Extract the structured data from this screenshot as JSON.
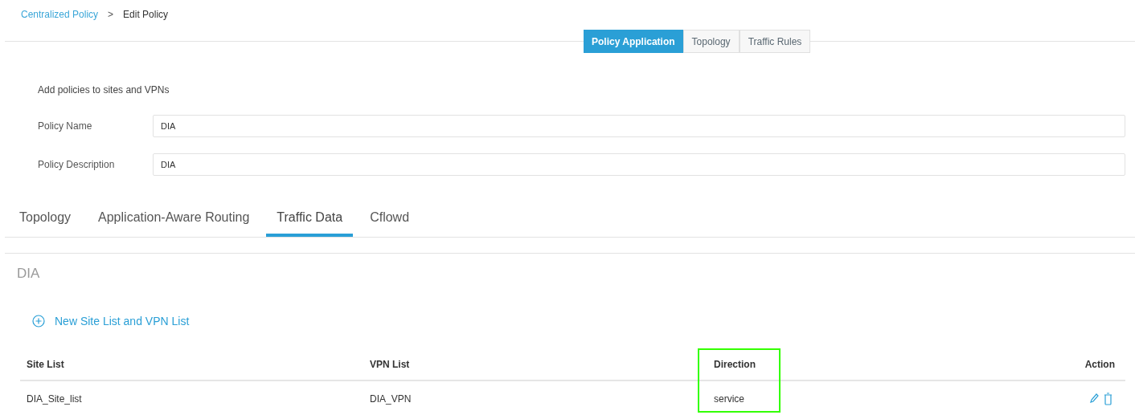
{
  "breadcrumb": {
    "parent": "Centralized Policy",
    "separator": ">",
    "current": "Edit Policy"
  },
  "top_tabs": [
    {
      "label": "Policy Application",
      "selected": true
    },
    {
      "label": "Topology",
      "selected": false
    },
    {
      "label": "Traffic Rules",
      "selected": false
    }
  ],
  "intro": "Add policies to sites and VPNs",
  "fields": [
    {
      "label": "Policy Name",
      "value": "DIA"
    },
    {
      "label": "Policy Description",
      "value": "DIA"
    }
  ],
  "section_tabs": [
    {
      "label": "Topology",
      "selected": false
    },
    {
      "label": "Application-Aware Routing",
      "selected": false
    },
    {
      "label": "Traffic Data",
      "selected": true
    },
    {
      "label": "Cflowd",
      "selected": false
    }
  ],
  "section_title": "DIA",
  "new_link": "New Site List and VPN List",
  "table": {
    "columns": [
      {
        "label": "Site List",
        "highlighted": false
      },
      {
        "label": "VPN List",
        "highlighted": false
      },
      {
        "label": "Direction",
        "highlighted": true
      },
      {
        "label": "Action",
        "highlighted": false
      }
    ],
    "rows": [
      {
        "cells": [
          "DIA_Site_list",
          "DIA_VPN",
          "service"
        ]
      }
    ]
  }
}
